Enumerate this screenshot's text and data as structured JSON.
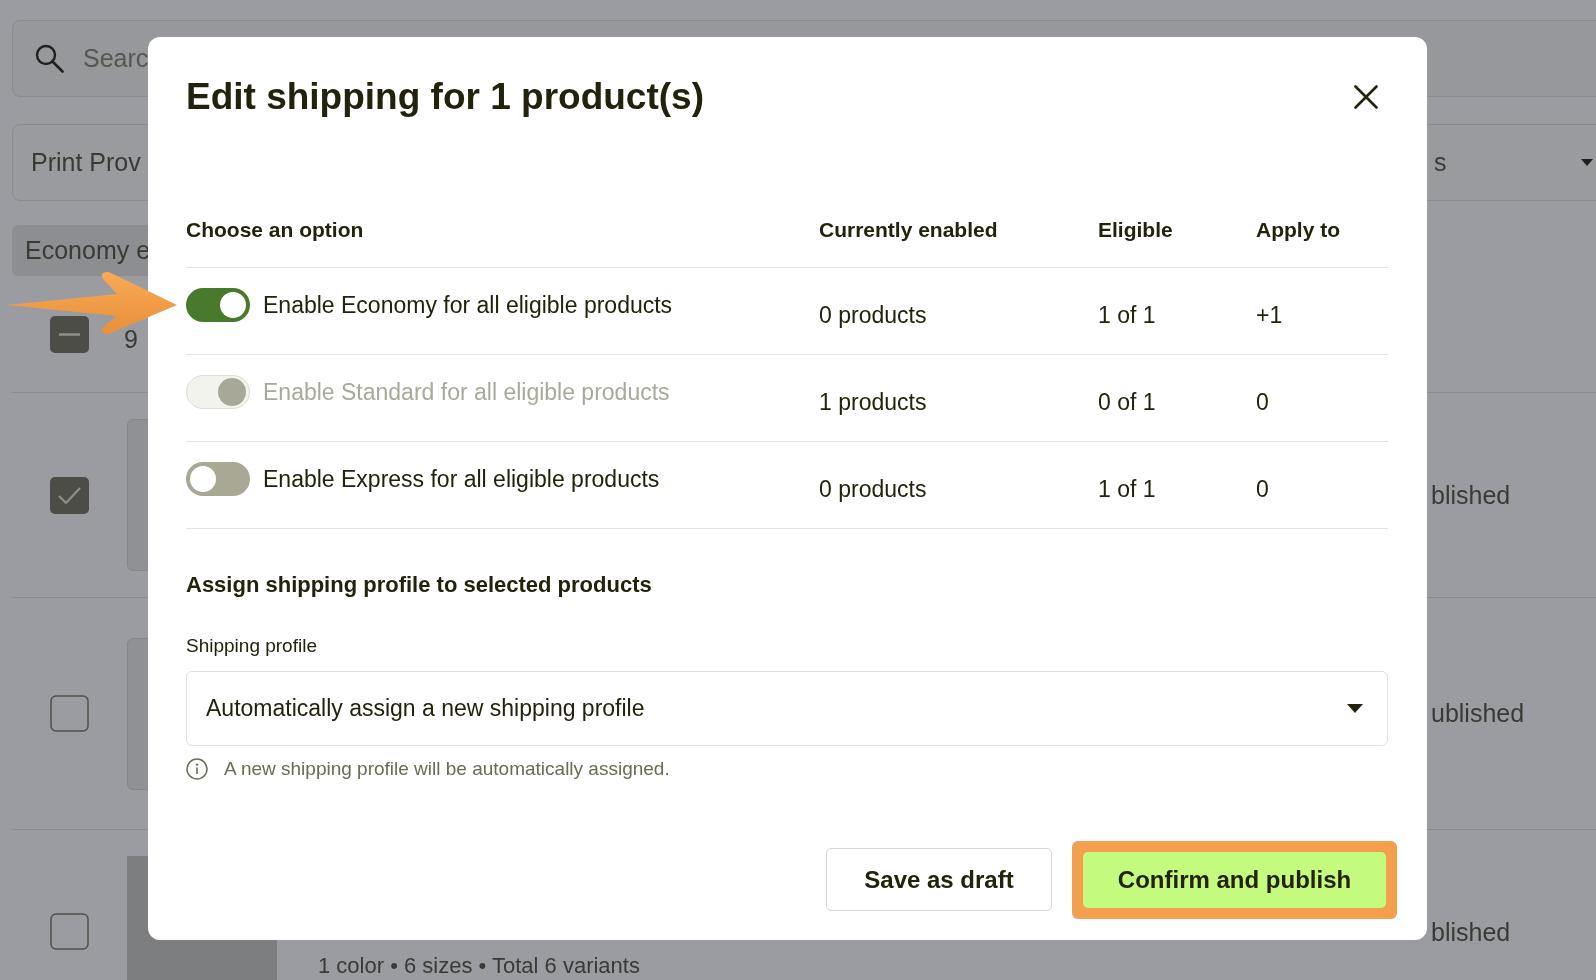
{
  "background_page": {
    "search": {
      "placeholder": "Searc"
    },
    "filters": [
      {
        "label": "Print Prov"
      },
      {
        "label": "s",
        "caret": true
      }
    ],
    "chip": {
      "label": "Economy e"
    },
    "select_all": {
      "indeterminate": true,
      "count": "9"
    },
    "rows": [
      {
        "checked": true,
        "kind": "image",
        "status": "blished"
      },
      {
        "checked": false,
        "kind": "image",
        "status": "ublished"
      },
      {
        "checked": false,
        "kind": "photo",
        "details": "1 color • 6 sizes • Total 6 variants",
        "status": "blished"
      }
    ]
  },
  "dialog": {
    "title": "Edit shipping for 1 product(s)",
    "columns": [
      "Choose an option",
      "Currently enabled",
      "Eligible",
      "Apply to"
    ],
    "options": [
      {
        "label": "Enable Economy for all eligible products",
        "on": true,
        "disabled": false,
        "currently_enabled": "0 products",
        "eligible": "1 of 1",
        "apply_to": "+1"
      },
      {
        "label": "Enable Standard for all eligible products",
        "on": true,
        "disabled": true,
        "currently_enabled": "1 products",
        "eligible": "0 of 1",
        "apply_to": "0"
      },
      {
        "label": "Enable Express for all eligible products",
        "on": false,
        "disabled": false,
        "currently_enabled": "0 products",
        "eligible": "1 of 1",
        "apply_to": "0"
      }
    ],
    "profile_section": {
      "heading": "Assign shipping profile to selected products",
      "label": "Shipping profile",
      "value": "Automatically assign a new shipping profile",
      "help": "A new shipping profile will be automatically assigned."
    },
    "buttons": [
      {
        "label": "Save as draft",
        "kind": "secondary",
        "highlighted": false
      },
      {
        "label": "Confirm and publish",
        "kind": "primary",
        "highlighted": true
      }
    ]
  }
}
